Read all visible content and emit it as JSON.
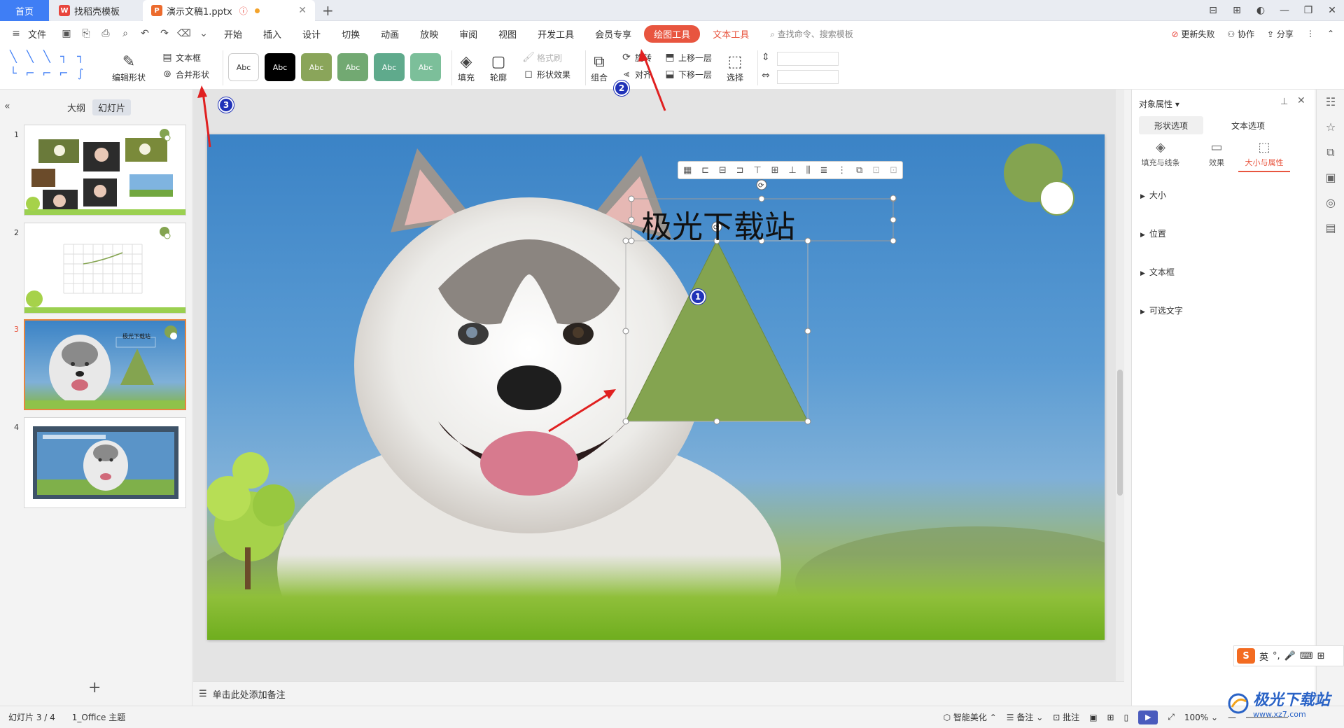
{
  "tabs": {
    "home": "首页",
    "template": "找稻壳模板",
    "doc": "演示文稿1.pptx"
  },
  "menu": {
    "file": "文件",
    "items": [
      "开始",
      "插入",
      "设计",
      "切换",
      "动画",
      "放映",
      "审阅",
      "视图",
      "开发工具",
      "会员专享"
    ],
    "draw_tools": "绘图工具",
    "text_tools": "文本工具",
    "search": "查找命令、搜索模板",
    "update_failed": "更新失败",
    "collaborate": "协作",
    "share": "分享"
  },
  "ribbon": {
    "edit_shape": "编辑形状",
    "text_box": "文本框",
    "merge_shape": "合并形状",
    "style_label": "Abc",
    "fill": "填充",
    "outline": "轮廓",
    "format_painter": "格式刷",
    "shape_effect": "形状效果",
    "group": "组合",
    "rotate": "旋转",
    "align": "对齐",
    "bring_forward": "上移一层",
    "send_backward": "下移一层",
    "select": "选择"
  },
  "left_panel": {
    "outline_tab": "大纲",
    "slides_tab": "幻灯片",
    "slide_numbers": [
      "1",
      "2",
      "3",
      "4"
    ],
    "current": 3
  },
  "slide": {
    "title_text": "极光下载站",
    "shape_color": "#84a450",
    "accent_circle": "#84a450"
  },
  "notes_placeholder": "单击此处添加备注",
  "right_panel": {
    "title": "对象属性",
    "tab_shape": "形状选项",
    "tab_text": "文本选项",
    "sub_fill": "填充与线条",
    "sub_effect": "效果",
    "sub_size": "大小与属性",
    "sections": [
      "大小",
      "位置",
      "文本框",
      "可选文字"
    ]
  },
  "status": {
    "slide_pos": "幻灯片 3 / 4",
    "theme": "1_Office 主题",
    "beautify": "智能美化",
    "notes": "备注",
    "comments": "批注",
    "zoom": "100%"
  },
  "ime": {
    "logo": "S",
    "lang": "英"
  },
  "watermark": {
    "title": "极光下载站",
    "url": "www.xz7.com"
  },
  "badges": [
    "1",
    "2",
    "3"
  ],
  "colors": {
    "accent": "#e8553f",
    "annotation_arrow": "#e02020",
    "badge": "#2032b8"
  }
}
